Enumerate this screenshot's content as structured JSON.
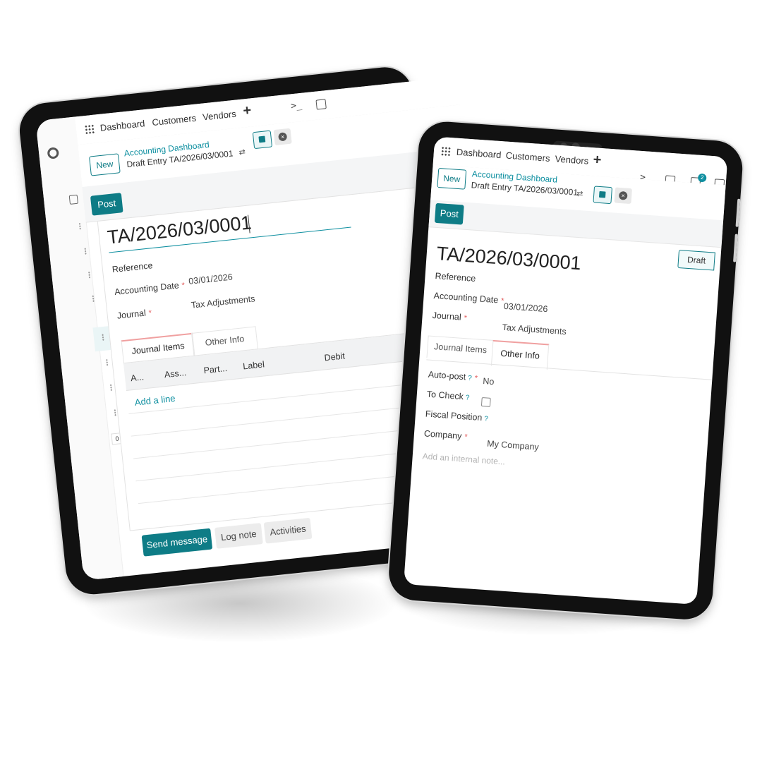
{
  "nav": {
    "dashboard": "Dashboard",
    "customers": "Customers",
    "vendors": "Vendors"
  },
  "icons": {
    "terminal": "terminal-icon",
    "split": "split-view-icon",
    "chat": "chat-icon",
    "apps": "apps-grid-icon"
  },
  "chat_badge": "2",
  "control": {
    "new_label": "New",
    "breadcrumb_parent": "Accounting Dashboard",
    "breadcrumb_current": "Draft Entry TA/2026/03/0001"
  },
  "actions": {
    "post_label": "Post",
    "status_draft": "Draft"
  },
  "record": {
    "title": "TA/2026/03/0001",
    "reference_label": "Reference",
    "accounting_date_label": "Accounting Date",
    "accounting_date_value": "03/01/2026",
    "journal_label": "Journal",
    "journal_value": "Tax Adjustments"
  },
  "tabs": {
    "journal_items": "Journal Items",
    "other_info": "Other Info"
  },
  "journal_table": {
    "columns": [
      "A...",
      "Ass...",
      "Part...",
      "Label",
      "Debit"
    ],
    "add_line": "Add a line"
  },
  "other_info": {
    "auto_post_label": "Auto-post",
    "auto_post_value": "No",
    "to_check_label": "To Check",
    "fiscal_position_label": "Fiscal Position",
    "company_label": "Company",
    "company_value": "My Company",
    "note_placeholder": "Add an internal note..."
  },
  "help_mark": "?",
  "required_mark": "*",
  "chatter": {
    "send_message": "Send message",
    "log_note": "Log note",
    "activities": "Activities"
  },
  "sidebar_counter": "0"
}
